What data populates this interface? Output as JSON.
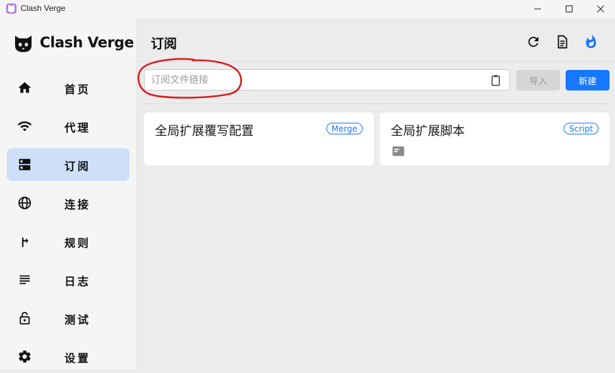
{
  "window": {
    "title": "Clash Verge",
    "controls": [
      "minimize-icon",
      "maximize-icon",
      "close-icon"
    ]
  },
  "sidebar": {
    "logo_text": "Clash Verge",
    "items": [
      {
        "label": "首页",
        "icon": "home-icon"
      },
      {
        "label": "代理",
        "icon": "wifi-icon"
      },
      {
        "label": "订阅",
        "icon": "dns-icon",
        "active": true
      },
      {
        "label": "连接",
        "icon": "globe-icon"
      },
      {
        "label": "规则",
        "icon": "fork-arrow-icon"
      },
      {
        "label": "日志",
        "icon": "list-lines-icon"
      },
      {
        "label": "测试",
        "icon": "lock-open-icon"
      },
      {
        "label": "设置",
        "icon": "gear-icon"
      }
    ]
  },
  "header": {
    "title": "订阅",
    "actions": [
      "refresh-icon",
      "document-icon",
      "fire-icon"
    ]
  },
  "subscription": {
    "url_placeholder": "订阅文件链接",
    "url_value": "",
    "import_label": "导入",
    "new_label": "新建"
  },
  "cards": [
    {
      "title": "全局扩展覆写配置",
      "badge": "Merge"
    },
    {
      "title": "全局扩展脚本",
      "badge": "Script",
      "icon": "doc-icon"
    }
  ],
  "colors": {
    "accent": "#1677ff",
    "active_nav_bg": "#cde0f7",
    "annotation": "#d62020"
  }
}
